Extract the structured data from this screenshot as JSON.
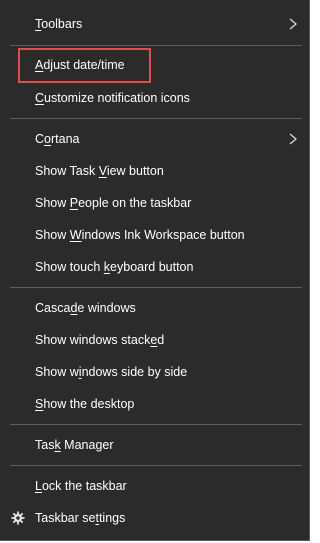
{
  "menu": {
    "items": [
      {
        "label": "Toolbars",
        "accel": "T",
        "submenu": true
      },
      {
        "label": "Adjust date/time",
        "accel": "A"
      },
      {
        "label": "Customize notification icons",
        "accel": "C"
      },
      {
        "label": "Cortana",
        "accel": "o",
        "submenu": true
      },
      {
        "label": "Show Task View button",
        "accel": "V"
      },
      {
        "label": "Show People on the taskbar",
        "accel": "P"
      },
      {
        "label": "Show Windows Ink Workspace button",
        "accel": "W"
      },
      {
        "label": "Show touch keyboard button",
        "accel": "k"
      },
      {
        "label": "Cascade windows",
        "accel": "d"
      },
      {
        "label": "Show windows stacked",
        "accel": "e"
      },
      {
        "label": "Show windows side by side",
        "accel": "i"
      },
      {
        "label": "Show the desktop",
        "accel": "S"
      },
      {
        "label": "Task Manager",
        "accel": "k"
      },
      {
        "label": "Lock the taskbar",
        "accel": "L"
      },
      {
        "label": "Taskbar settings",
        "accel": "t",
        "icon": "gear-icon"
      }
    ]
  },
  "colors": {
    "background": "#2b2b2b",
    "text": "#ffffff",
    "separator": "#5e5e5e",
    "highlight_border": "#e14c4c"
  }
}
